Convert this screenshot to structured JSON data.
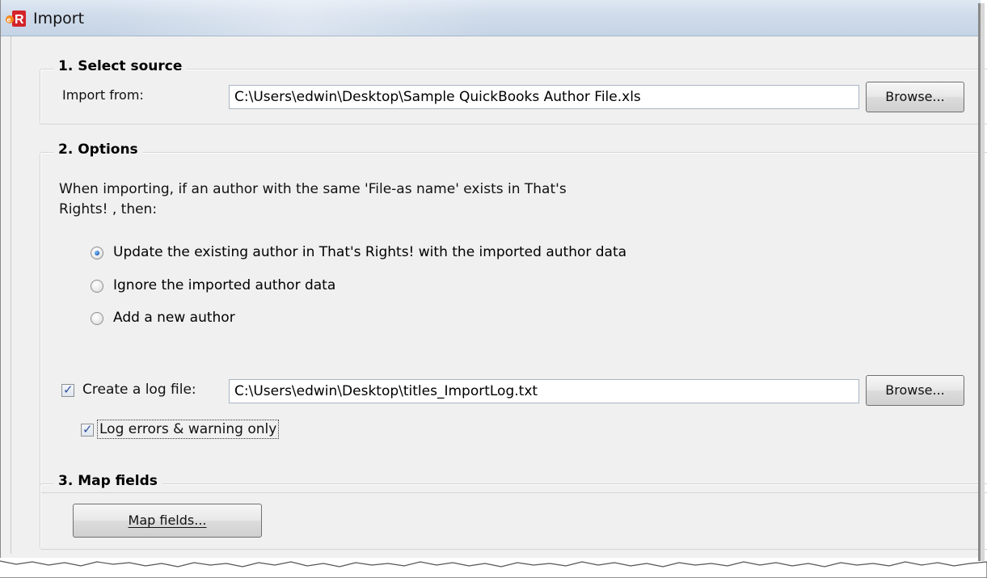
{
  "window": {
    "title": "Import",
    "icon": "er-app-icon"
  },
  "source": {
    "heading": "1. Select source",
    "import_from_label": "Import from:",
    "import_from_value": "C:\\Users\\edwin\\Desktop\\Sample QuickBooks Author File.xls",
    "browse_label": "Browse..."
  },
  "options": {
    "heading": "2. Options",
    "description_line1": "When importing, if an author with the same 'File-as name' exists in That's",
    "description_line2": "Rights! , then:",
    "radios": [
      {
        "label": "Update the existing author in That's Rights! with the imported author data",
        "selected": true
      },
      {
        "label": "Ignore the imported author data",
        "selected": false
      },
      {
        "label": "Add a new author",
        "selected": false
      }
    ],
    "create_log_label": "Create a log file:",
    "create_log_checked": true,
    "log_file_value": "C:\\Users\\edwin\\Desktop\\titles_ImportLog.txt",
    "log_browse_label": "Browse...",
    "log_errors_label": "Log errors & warning only",
    "log_errors_checked": true
  },
  "map": {
    "heading": "3. Map fields",
    "button_label": "Map fields..."
  },
  "colors": {
    "window_bg": "#f0f0f0",
    "titlebar": "#cfdbea",
    "radio_selected": "#2f6fc1"
  }
}
